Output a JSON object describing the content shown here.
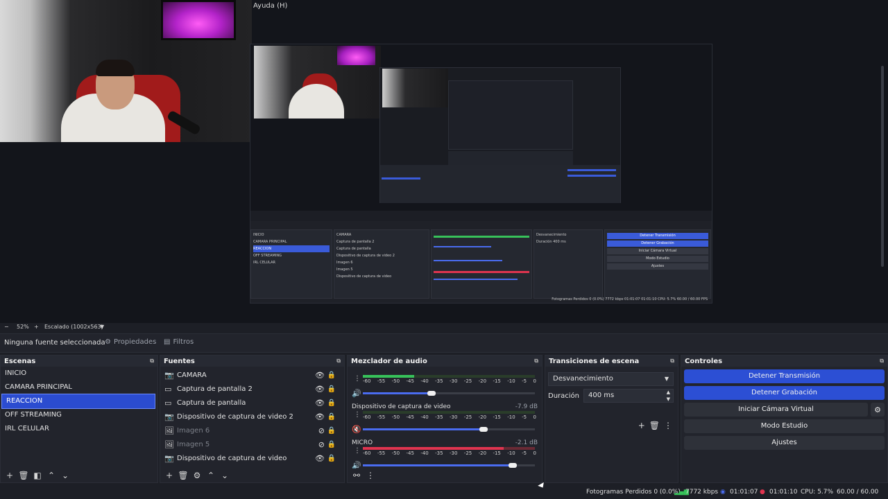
{
  "window": {
    "menu_fragment": "Ayuda (H)"
  },
  "zoom": {
    "percent": "52%",
    "plus": "+",
    "minus": "−",
    "scale_label": "Escalado (1002x563)"
  },
  "toolbar": {
    "no_source": "Ninguna fuente seleccionada",
    "properties": "Propiedades",
    "filters": "Filtros"
  },
  "scenes": {
    "title": "Escenas",
    "items": [
      "INICIO",
      "CAMARA PRINCIPAL",
      "REACCION",
      "OFF STREAMING",
      "IRL CELULAR"
    ],
    "selected_index": 2
  },
  "sources": {
    "title": "Fuentes",
    "items": [
      {
        "label": "CAMARA",
        "icon": "camera-icon",
        "visible": true
      },
      {
        "label": "Captura de pantalla 2",
        "icon": "monitor-icon",
        "visible": true
      },
      {
        "label": "Captura de pantalla",
        "icon": "monitor-icon",
        "visible": true
      },
      {
        "label": "Dispositivo de captura de video 2",
        "icon": "camera-icon",
        "visible": true
      },
      {
        "label": "Imagen 6",
        "icon": "image-icon",
        "visible": false
      },
      {
        "label": "Imagen 5",
        "icon": "image-icon",
        "visible": false
      },
      {
        "label": "Dispositivo de captura de video",
        "icon": "camera-icon",
        "visible": true
      }
    ]
  },
  "mixer": {
    "title": "Mezclador de audio",
    "ticks": [
      "-60",
      "-55",
      "-50",
      "-45",
      "-40",
      "-35",
      "-30",
      "-25",
      "-20",
      "-15",
      "-10",
      "-5",
      "0"
    ],
    "channels": [
      {
        "name": "",
        "db": "",
        "level": 0.3,
        "fader": 0.4,
        "muted": false
      },
      {
        "name": "Dispositivo de captura de video",
        "db": "-7.9 dB",
        "level": 0.0,
        "fader": 0.7,
        "muted": true
      },
      {
        "name": "MICRO",
        "db": "-2.1 dB",
        "level": 0.82,
        "fader": 0.87,
        "muted": false
      }
    ]
  },
  "transitions": {
    "title": "Transiciones de escena",
    "selected": "Desvanecimiento",
    "duration_label": "Duración",
    "duration_value": "400 ms"
  },
  "controls": {
    "title": "Controles",
    "stop_stream": "Detener Transmisión",
    "stop_record": "Detener Grabación",
    "virtual_cam": "Iniciar Cámara Virtual",
    "studio_mode": "Modo Estudio",
    "settings": "Ajustes"
  },
  "status": {
    "dropped_frames": "Fotogramas Perdidos 0 (0.0%)",
    "bitrate": "7772 kbps",
    "stream_time": "01:01:07",
    "record_time": "01:01:10",
    "cpu": "CPU: 5.7%",
    "fps": "60.00 / 60.00 FPS"
  },
  "colors": {
    "accent": "#2c4fd4",
    "meter_green": "#37c25a",
    "meter_red": "#e0344f",
    "bg": "#1d1f26"
  }
}
